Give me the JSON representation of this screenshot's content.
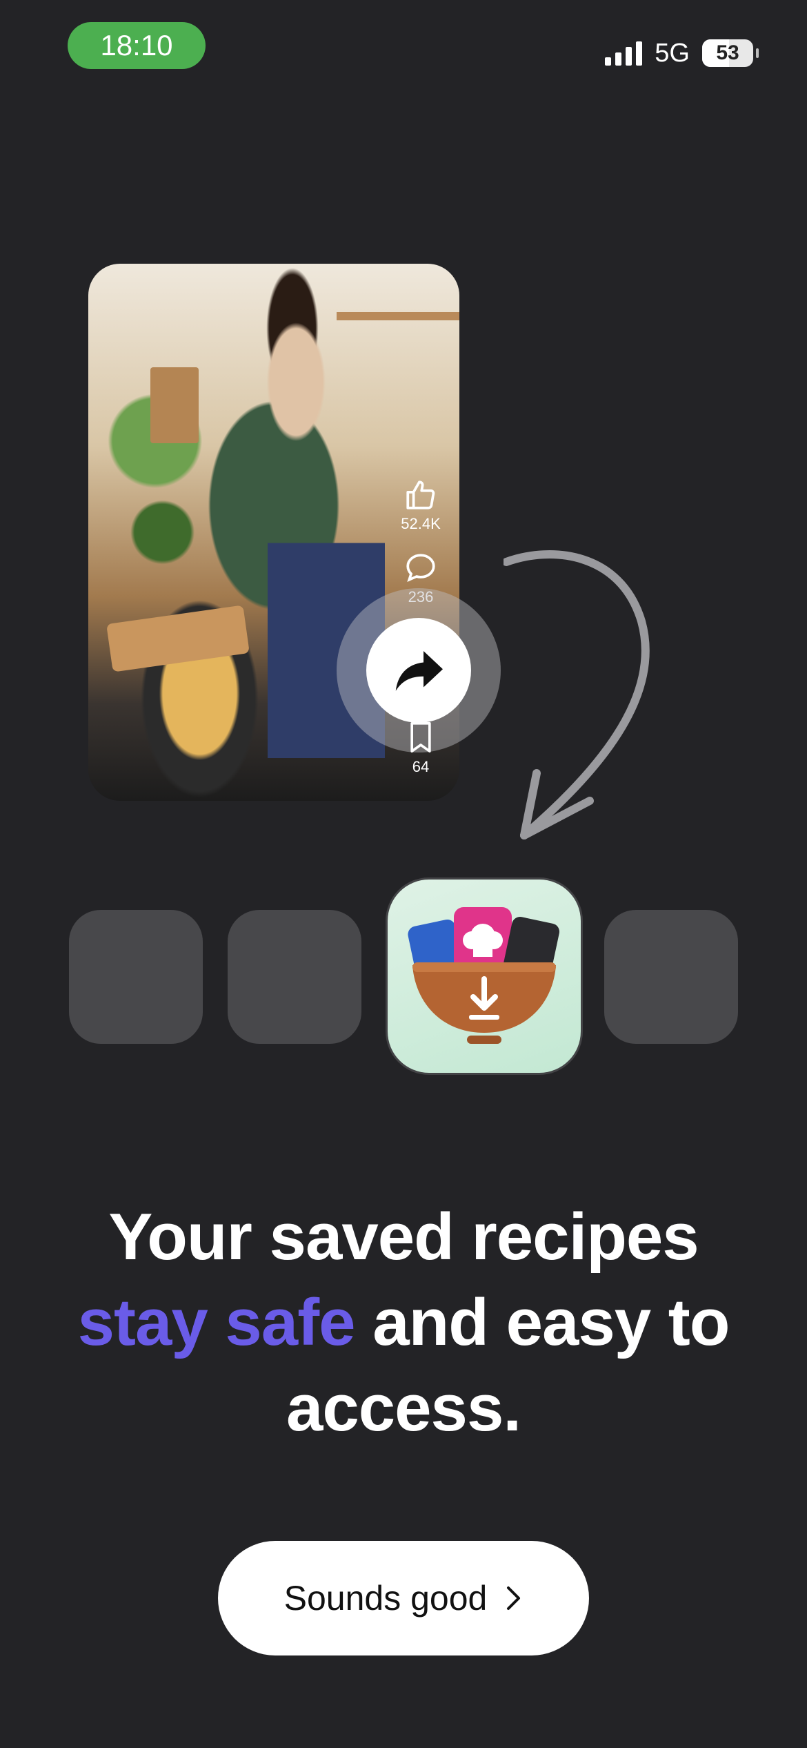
{
  "status_bar": {
    "time": "18:10",
    "network": "5G",
    "battery": "53",
    "battery_level_percent": 53,
    "time_pill_color": "#4caf50"
  },
  "video": {
    "likes": "52.4K",
    "comments": "236",
    "saves": "64"
  },
  "headline": {
    "part1": "Your saved recipes",
    "accent": "stay safe",
    "part2": "and easy to access."
  },
  "colors": {
    "accent": "#6a5ce8",
    "background": "#232326"
  },
  "cta": {
    "label": "Sounds good"
  }
}
